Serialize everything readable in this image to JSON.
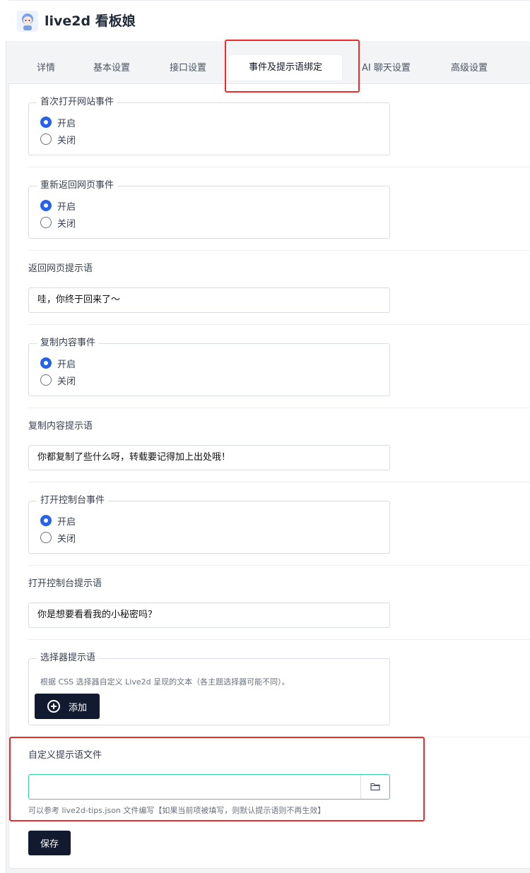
{
  "header": {
    "title": "live2d 看板娘",
    "logo_icon": "mascot-avatar-icon"
  },
  "tabs": [
    {
      "label": "详情"
    },
    {
      "label": "基本设置"
    },
    {
      "label": "接口设置"
    },
    {
      "label": "事件及提示语绑定",
      "active": true
    },
    {
      "label": "AI 聊天设置"
    },
    {
      "label": "高级设置"
    }
  ],
  "events": {
    "first_open": {
      "legend": "首次打开网站事件",
      "options": [
        "开启",
        "关闭"
      ],
      "selected": "开启"
    },
    "return_page": {
      "legend": "重新返回网页事件",
      "options": [
        "开启",
        "关闭"
      ],
      "selected": "开启"
    },
    "return_tip": {
      "label": "返回网页提示语",
      "value": "哇，你终于回来了～"
    },
    "copy": {
      "legend": "复制内容事件",
      "options": [
        "开启",
        "关闭"
      ],
      "selected": "开启"
    },
    "copy_tip": {
      "label": "复制内容提示语",
      "value": "你都复制了些什么呀，转载要记得加上出处哦！"
    },
    "console": {
      "legend": "打开控制台事件",
      "options": [
        "开启",
        "关闭"
      ],
      "selected": "开启"
    },
    "console_tip": {
      "label": "打开控制台提示语",
      "value": "你是想要看看我的小秘密吗？"
    },
    "selector": {
      "legend": "选择器提示语",
      "help": "根据 CSS 选择器自定义 Live2d 呈现的文本（各主题选择器可能不同）。",
      "add_label": "添加"
    },
    "custom_file": {
      "label": "自定义提示语文件",
      "value": "",
      "help": "可以参考 live2d-tips.json 文件编写【如果当前项被填写，则默认提示语则不再生效】",
      "folder_icon": "folder-icon"
    }
  },
  "save_label": "保存",
  "colors": {
    "accent": "#2563eb",
    "dark_button": "#111a2e",
    "highlight": "#ee2a2a",
    "focus_border": "#34d399"
  }
}
